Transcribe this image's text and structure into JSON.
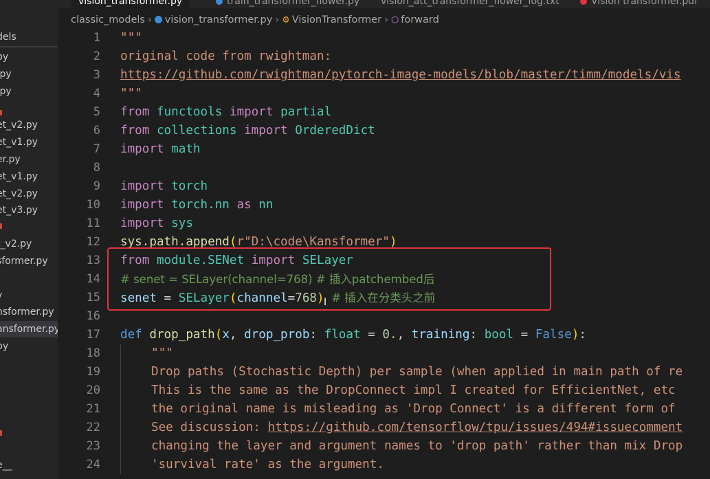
{
  "tabs": [
    {
      "label": "vision_transformer.py",
      "active": true
    },
    {
      "label": "train_transformer_flower.py",
      "active": false
    },
    {
      "label": "vision_att_transformer_flower_log.txt",
      "active": false
    },
    {
      "label": "Vision transformer.pdf",
      "active": false
    }
  ],
  "breadcrumb": {
    "folder": "classic_models",
    "file": "vision_transformer.py",
    "class": "VisionTransformer",
    "method": "forward"
  },
  "sidebar": {
    "items": [
      "dels",
      "py",
      ".py",
      ".py",
      "",
      "et_v2.py",
      "et_v1.py",
      "er.py",
      "et_v1.py",
      "et_v2.py",
      "et_v3.py",
      "",
      "t_v2.py",
      "sformer.py",
      "",
      "y",
      "nsformer.py",
      "ansformer.py",
      "py",
      "",
      "",
      "",
      "",
      "e__"
    ]
  },
  "editor": {
    "lines": [
      {
        "n": "1"
      },
      {
        "n": "2"
      },
      {
        "n": "3"
      },
      {
        "n": "4"
      },
      {
        "n": "5"
      },
      {
        "n": "6"
      },
      {
        "n": "7"
      },
      {
        "n": "8"
      },
      {
        "n": "9"
      },
      {
        "n": "10"
      },
      {
        "n": "11"
      },
      {
        "n": "12"
      },
      {
        "n": "13"
      },
      {
        "n": "14"
      },
      {
        "n": "15"
      },
      {
        "n": "16"
      },
      {
        "n": "17"
      },
      {
        "n": "18"
      },
      {
        "n": "19"
      },
      {
        "n": "20"
      },
      {
        "n": "21"
      },
      {
        "n": "22"
      },
      {
        "n": "23"
      },
      {
        "n": "24"
      }
    ],
    "text": {
      "l1_doc": "\"\"\"",
      "l2_doc": "original code from rwightman:",
      "l3_url": "https://github.com/rwightman/pytorch-image-models/blob/master/timm/models/vis",
      "l4_doc": "\"\"\"",
      "l5_mod": "functools",
      "l5_name": "partial",
      "l6_mod": "collections",
      "l6_name": "OrderedDict",
      "l7_mod": "math",
      "l9_mod": "torch",
      "l10_mod": "torch.nn",
      "l10_alias": "nn",
      "l11_mod": "sys",
      "l12_call": "sys.path.append",
      "l12_str": "r\"D:\\code\\Kansformer\"",
      "l13_mod": "module.SENet",
      "l13_name": "SELayer",
      "l14_comment": "# senet = SELayer(channel=768) # 插入patchembed后",
      "l15_var": "senet",
      "l15_func": "SELayer",
      "l15_param": "channel",
      "l15_num": "768",
      "l15_comment": "# 插入在分类头之前",
      "l17_func": "drop_path",
      "l17_x": "x",
      "l17_p1": "drop_prob",
      "l17_t1": "float",
      "l17_v1": "0.",
      "l17_p2": "training",
      "l17_t2": "bool",
      "l17_v2": "False",
      "l18_doc": "\"\"\"",
      "l19_doc": "Drop paths (Stochastic Depth) per sample (when applied in main path of re",
      "l20_doc": "This is the same as the DropConnect impl I created for EfficientNet, etc",
      "l21_doc": "the original name is misleading as 'Drop Connect' is a different form of",
      "l22_pre": "See discussion: ",
      "l22_url": "https://github.com/tensorflow/tpu/issues/494#issuecomment",
      "l23_doc": "changing the layer and argument names to 'drop path' rather than mix Drop",
      "l24_doc": "'survival rate' as the argument."
    },
    "keywords": {
      "from": "from",
      "import": "import",
      "as": "as",
      "def": "def"
    }
  },
  "colors": {
    "background": "#1e1e1e",
    "keyword_control": "#c586c0",
    "keyword_def": "#569cd6",
    "string": "#ce9178",
    "module": "#4ec9b0",
    "variable": "#9cdcfe",
    "function": "#dcdcaa",
    "number": "#b5cea8",
    "comment": "#6a9955",
    "highlight_box": "#e0343c"
  }
}
